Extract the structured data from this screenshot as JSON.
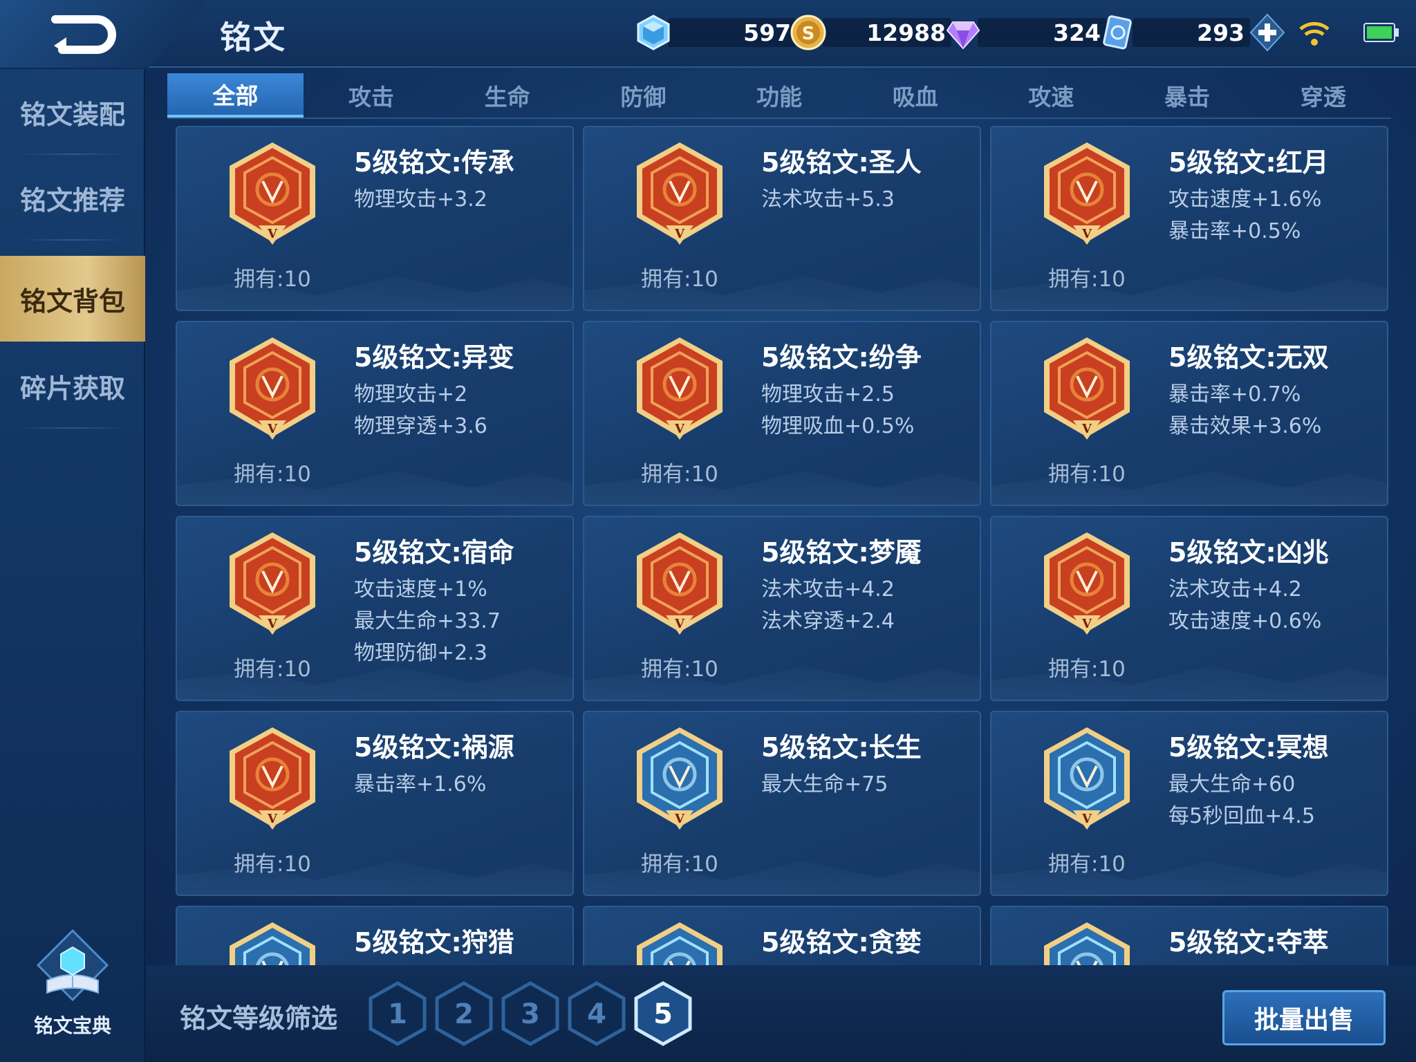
{
  "header": {
    "title": "铭文",
    "resources": [
      {
        "name": "diamond-crystal",
        "value": "597"
      },
      {
        "name": "gold-coin",
        "value": "12988"
      },
      {
        "name": "purple-gem",
        "value": "324"
      },
      {
        "name": "voucher-card",
        "value": "293"
      }
    ]
  },
  "sidebar": {
    "items": [
      {
        "label": "铭文装配",
        "active": false
      },
      {
        "label": "铭文推荐",
        "active": false
      },
      {
        "label": "铭文背包",
        "active": true
      },
      {
        "label": "碎片获取",
        "active": false
      }
    ],
    "codex_label": "铭文宝典"
  },
  "tabs": [
    "全部",
    "攻击",
    "生命",
    "防御",
    "功能",
    "吸血",
    "攻速",
    "暴击",
    "穿透"
  ],
  "active_tab": 0,
  "runes": [
    {
      "name": "5级铭文:传承",
      "stats": [
        "物理攻击+3.2"
      ],
      "owned": "拥有:10",
      "color": "red"
    },
    {
      "name": "5级铭文:圣人",
      "stats": [
        "法术攻击+5.3"
      ],
      "owned": "拥有:10",
      "color": "red"
    },
    {
      "name": "5级铭文:红月",
      "stats": [
        "攻击速度+1.6%",
        "暴击率+0.5%"
      ],
      "owned": "拥有:10",
      "color": "red"
    },
    {
      "name": "5级铭文:异变",
      "stats": [
        "物理攻击+2",
        "物理穿透+3.6"
      ],
      "owned": "拥有:10",
      "color": "red"
    },
    {
      "name": "5级铭文:纷争",
      "stats": [
        "物理攻击+2.5",
        "物理吸血+0.5%"
      ],
      "owned": "拥有:10",
      "color": "red"
    },
    {
      "name": "5级铭文:无双",
      "stats": [
        "暴击率+0.7%",
        "暴击效果+3.6%"
      ],
      "owned": "拥有:10",
      "color": "red"
    },
    {
      "name": "5级铭文:宿命",
      "stats": [
        "攻击速度+1%",
        "最大生命+33.7",
        "物理防御+2.3"
      ],
      "owned": "拥有:10",
      "color": "red"
    },
    {
      "name": "5级铭文:梦魇",
      "stats": [
        "法术攻击+4.2",
        "法术穿透+2.4"
      ],
      "owned": "拥有:10",
      "color": "red"
    },
    {
      "name": "5级铭文:凶兆",
      "stats": [
        "法术攻击+4.2",
        "攻击速度+0.6%"
      ],
      "owned": "拥有:10",
      "color": "red"
    },
    {
      "name": "5级铭文:祸源",
      "stats": [
        "暴击率+1.6%"
      ],
      "owned": "拥有:10",
      "color": "red"
    },
    {
      "name": "5级铭文:长生",
      "stats": [
        "最大生命+75"
      ],
      "owned": "拥有:10",
      "color": "blue"
    },
    {
      "name": "5级铭文:冥想",
      "stats": [
        "最大生命+60",
        "每5秒回血+4.5"
      ],
      "owned": "拥有:10",
      "color": "blue"
    },
    {
      "name": "5级铭文:狩猎",
      "stats": [],
      "owned": "",
      "color": "blue"
    },
    {
      "name": "5级铭文:贪婪",
      "stats": [],
      "owned": "",
      "color": "blue"
    },
    {
      "name": "5级铭文:夺萃",
      "stats": [],
      "owned": "",
      "color": "blue"
    }
  ],
  "filter": {
    "label": "铭文等级筛选",
    "levels": [
      "1",
      "2",
      "3",
      "4",
      "5"
    ],
    "selected": "5"
  },
  "sell_button": "批量出售",
  "colors": {
    "accent_gold": "#d9bc7a",
    "accent_blue": "#3c88d8",
    "rune_red": "#d8532a",
    "rune_blue": "#2f7fc4"
  }
}
